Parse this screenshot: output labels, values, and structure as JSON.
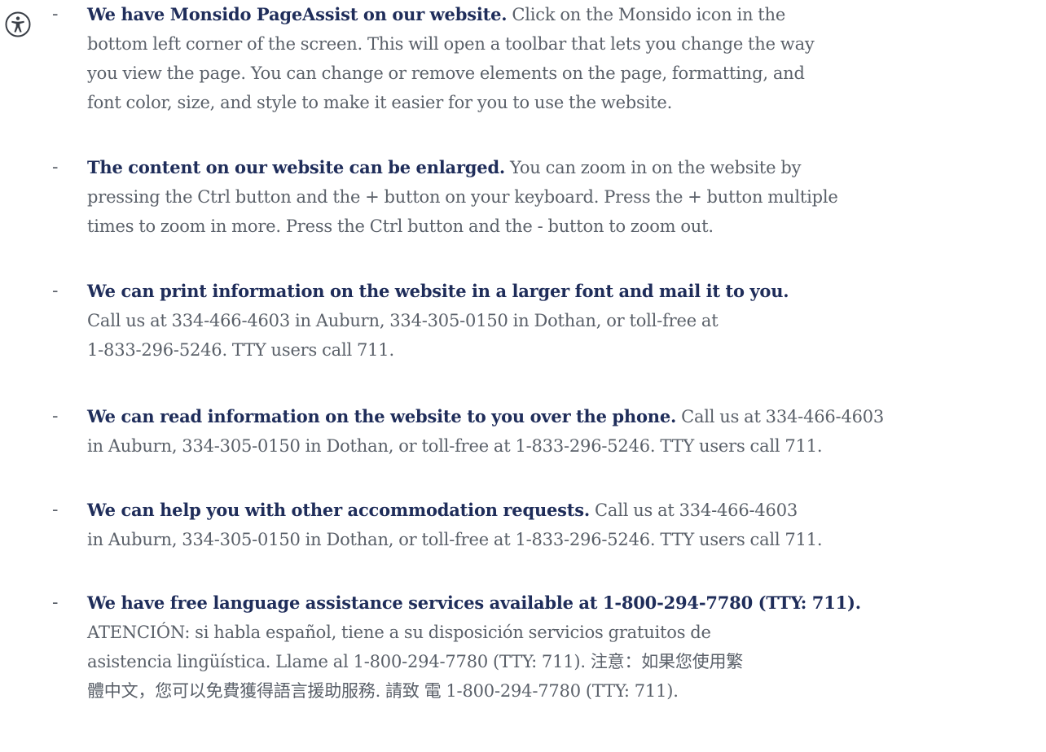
{
  "icons": {
    "accessibility": "accessibility-person-icon"
  },
  "colors": {
    "lead_text": "#1f2d5a",
    "body_text": "#5a6069",
    "background": "#ffffff"
  },
  "items": [
    {
      "bullet": "-",
      "lines": [
        {
          "lead": "We have Monsido PageAssist on our website.",
          "body": "Click on the Monsido icon in the"
        },
        {
          "lead": "",
          "body": "bottom left corner of the screen. This will open a toolbar that lets you change the way"
        },
        {
          "lead": "",
          "body": "you view the page. You can change or remove elements on the page, formatting, and"
        },
        {
          "lead": "",
          "body": "font color, size, and style to make it easier for you to use the website."
        }
      ]
    },
    {
      "bullet": "-",
      "lines": [
        {
          "lead": "The content on our website can be enlarged.",
          "body": " You can zoom in on the website by"
        },
        {
          "lead": "",
          "body": "pressing the Ctrl button and the + button on your keyboard. Press the + button multiple"
        },
        {
          "lead": "",
          "body": "times to zoom in more. Press the Ctrl button and the - button to zoom out."
        }
      ]
    },
    {
      "bullet": "-",
      "lines": [
        {
          "lead": "We can print information on the website in a larger font and mail it to you.",
          "body": ""
        },
        {
          "lead": "",
          "body": "Call us at 334-466-4603 in Auburn, 334-305-0150 in Dothan, or toll-free at"
        },
        {
          "lead": "",
          "body": "1-833-296-5246. TTY users call 711."
        }
      ]
    },
    {
      "bullet": "-",
      "lines": [
        {
          "lead": "We can read information on the website to you over the phone.",
          "body": "Call us at 334-466-4603"
        },
        {
          "lead": "",
          "body": "in Auburn, 334-305-0150 in Dothan, or toll-free at 1-833-296-5246. TTY users call 711."
        }
      ]
    },
    {
      "bullet": "-",
      "lines": [
        {
          "lead": "We can help you with other accommodation requests.",
          "body": "Call us at 334-466-4603"
        },
        {
          "lead": "",
          "body": "in Auburn, 334-305-0150 in Dothan, or toll-free at 1-833-296-5246. TTY users call 711."
        }
      ]
    },
    {
      "bullet": "-",
      "lines": [
        {
          "lead": "We have free language assistance services available at 1-800-294-7780 (TTY: 711).",
          "body": ""
        },
        {
          "lead": "",
          "body": "ATENCIÓN: si habla español, tiene a su disposición servicios gratuitos de"
        },
        {
          "lead": "",
          "body": "asistencia lingüística. Llame al 1-800-294-7780 (TTY: 711). 注意：如果您使用繁"
        },
        {
          "lead": "",
          "body": "體中文，您可以免費獲得語言援助服務. 請致 電 1-800-294-7780 (TTY: 711)."
        }
      ]
    }
  ]
}
